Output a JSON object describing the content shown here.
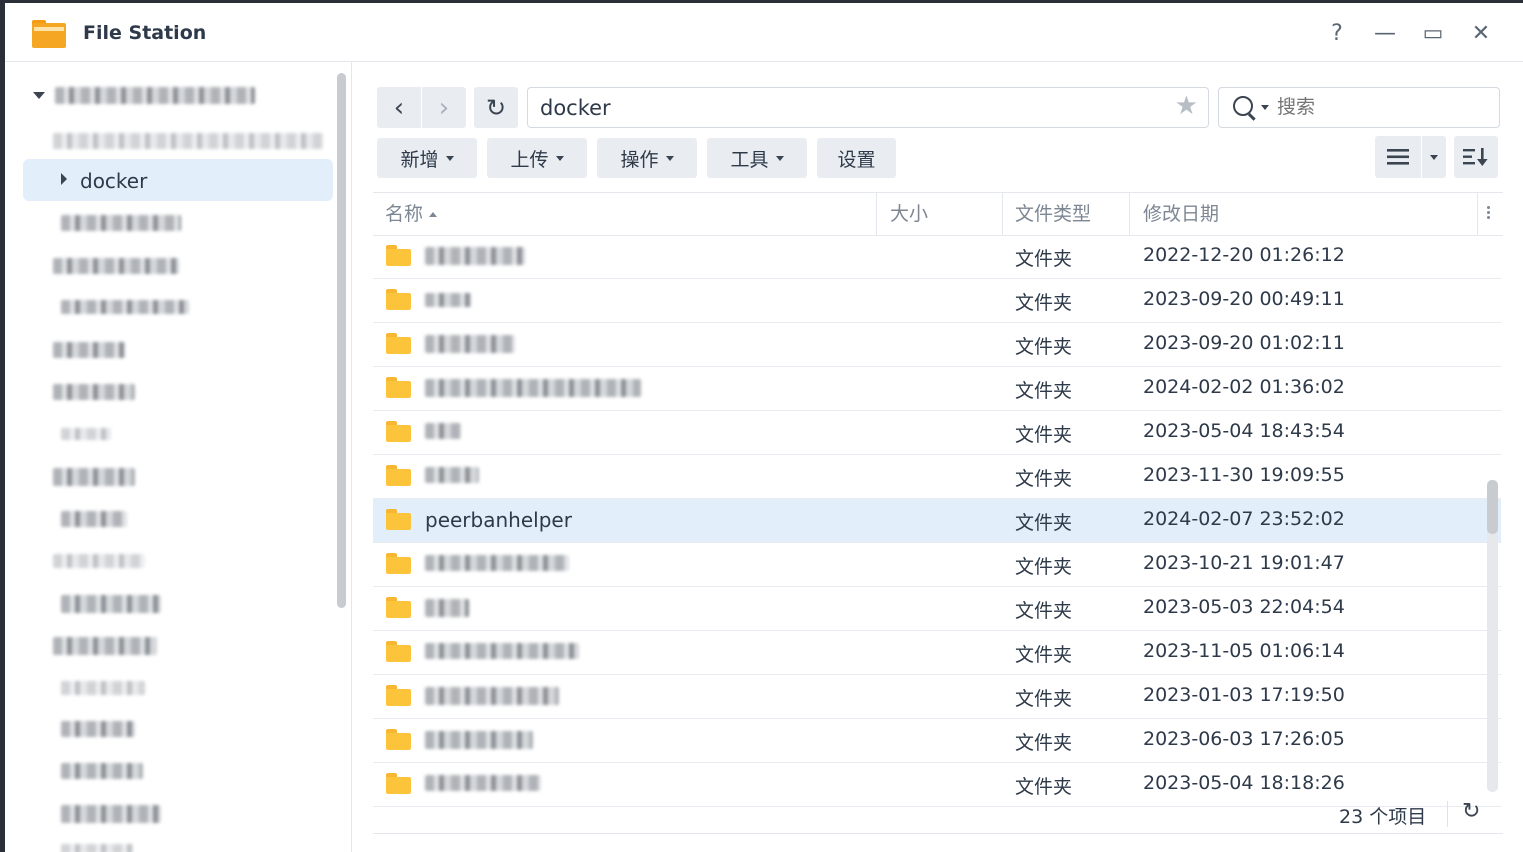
{
  "window": {
    "title": "File Station",
    "help_label": "?",
    "minimize_label": "—",
    "maximize_label": "▭",
    "close_label": "✕"
  },
  "sidebar": {
    "selected_folder": "docker"
  },
  "toolbar": {
    "back_label": "‹",
    "forward_label": "›",
    "refresh_label": "↻",
    "path": "docker",
    "star_label": "★",
    "search_placeholder": "搜索",
    "create_label": "新增",
    "upload_label": "上传",
    "action_label": "操作",
    "tools_label": "工具",
    "settings_label": "设置"
  },
  "table": {
    "columns": {
      "name": "名称",
      "size": "大小",
      "type": "文件类型",
      "modified": "修改日期"
    },
    "rows": [
      {
        "type": "文件夹",
        "modified": "2022-12-20 01:26:12"
      },
      {
        "type": "文件夹",
        "modified": "2023-09-20 00:49:11"
      },
      {
        "type": "文件夹",
        "modified": "2023-09-20 01:02:11"
      },
      {
        "type": "文件夹",
        "modified": "2024-02-02 01:36:02"
      },
      {
        "type": "文件夹",
        "modified": "2023-05-04 18:43:54"
      },
      {
        "type": "文件夹",
        "modified": "2023-11-30 19:09:55"
      },
      {
        "name": "peerbanhelper",
        "type": "文件夹",
        "modified": "2024-02-07 23:52:02",
        "selected": true
      },
      {
        "type": "文件夹",
        "modified": "2023-10-21 19:01:47"
      },
      {
        "type": "文件夹",
        "modified": "2023-05-03 22:04:54"
      },
      {
        "type": "文件夹",
        "modified": "2023-11-05 01:06:14"
      },
      {
        "type": "文件夹",
        "modified": "2023-01-03 17:19:50"
      },
      {
        "type": "文件夹",
        "modified": "2023-06-03 17:26:05"
      },
      {
        "type": "文件夹",
        "modified": "2023-05-04 18:18:26"
      }
    ]
  },
  "footer": {
    "item_count": "23 个项目",
    "refresh_label": "↻"
  },
  "colors": {
    "accent_selection": "#e3eefb",
    "folder": "#fcc43a",
    "button_bg": "#e9edf2"
  }
}
